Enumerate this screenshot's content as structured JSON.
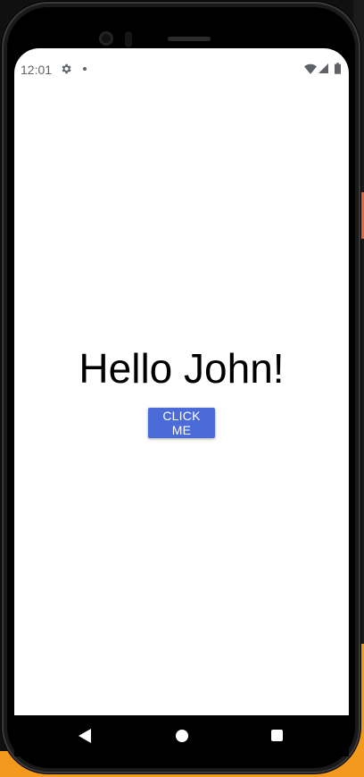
{
  "status_bar": {
    "time": "12:01",
    "icons": [
      "gear-icon",
      "notification-dot-icon",
      "wifi-icon",
      "signal-icon",
      "battery-icon"
    ]
  },
  "main": {
    "greeting": "Hello John!",
    "button_label": "CLICK ME"
  },
  "nav_bar": {
    "icons": [
      "back-icon",
      "home-icon",
      "recents-icon"
    ]
  },
  "colors": {
    "button_background": "#4a6bd8",
    "button_text": "#ffffff",
    "screen_background": "#ffffff",
    "status_text": "#5f6368"
  }
}
